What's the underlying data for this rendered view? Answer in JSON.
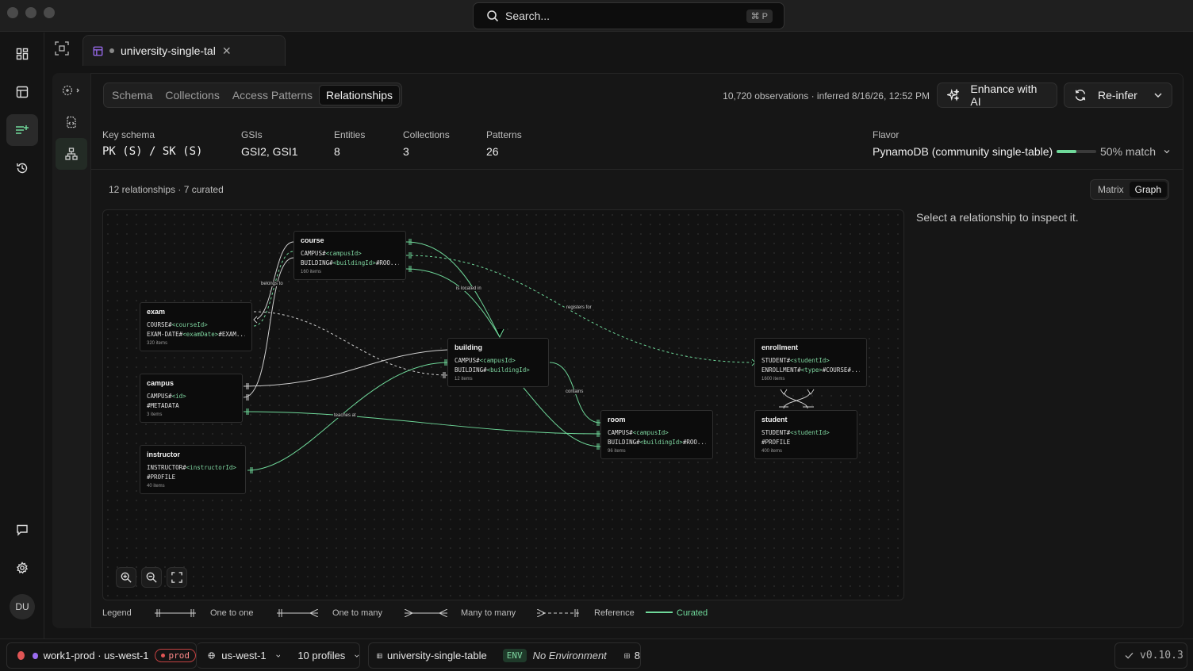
{
  "search": {
    "placeholder": "Search...",
    "shortcut": "⌘ P"
  },
  "tab": {
    "title": "university-single-tal"
  },
  "user": {
    "initials": "DU"
  },
  "view_tabs": [
    "Schema",
    "Collections",
    "Access Patterns",
    "Relationships"
  ],
  "header": {
    "observations": "10,720 observations · inferred 8/16/26, 12:52 PM",
    "enhance_label": "Enhance with AI",
    "reinfer_label": "Re-infer"
  },
  "stats": {
    "key_schema_label": "Key schema",
    "key_schema_value": "PK (S) / SK (S)",
    "gsis_label": "GSIs",
    "gsis_value": "GSI2, GSI1",
    "entities_label": "Entities",
    "entities_value": "8",
    "collections_label": "Collections",
    "collections_value": "3",
    "patterns_label": "Patterns",
    "patterns_value": "26",
    "flavor_label": "Flavor",
    "flavor_value": "PynamoDB (community single-table)",
    "match_fraction": 0.5,
    "match_label": "50% match"
  },
  "relationships": {
    "summary": "12 relationships · 7 curated",
    "view_options": [
      "Matrix",
      "Graph"
    ],
    "active_view": "Graph",
    "inspect_hint": "Select a relationship to inspect it."
  },
  "graph": {
    "nodes": {
      "course": {
        "name": "course",
        "keys": [
          [
            "CAMPUS#",
            "<campusId>",
            ""
          ],
          [
            "BUILDING#",
            "<buildingId>",
            "#ROO..."
          ]
        ],
        "count": "160 items"
      },
      "exam": {
        "name": "exam",
        "keys": [
          [
            "COURSE#",
            "<courseId>",
            ""
          ],
          [
            "EXAM-DATE#",
            "<examDate>",
            "#EXAM..."
          ]
        ],
        "count": "320 items"
      },
      "campus": {
        "name": "campus",
        "keys": [
          [
            "CAMPUS#",
            "<id>",
            ""
          ],
          [
            "#METADATA",
            "",
            ""
          ]
        ],
        "count": "3 items"
      },
      "instructor": {
        "name": "instructor",
        "keys": [
          [
            "INSTRUCTOR#",
            "<instructorId>",
            ""
          ],
          [
            "#PROFILE",
            "",
            ""
          ]
        ],
        "count": "40 items"
      },
      "building": {
        "name": "building",
        "keys": [
          [
            "CAMPUS#",
            "<campusId>",
            ""
          ],
          [
            "BUILDING#",
            "<buildingId>",
            ""
          ]
        ],
        "count": "12 items"
      },
      "room": {
        "name": "room",
        "keys": [
          [
            "CAMPUS#",
            "<campusId>",
            ""
          ],
          [
            "BUILDING#",
            "<buildingId>",
            "#ROO..."
          ]
        ],
        "count": "96 items"
      },
      "enrollment": {
        "name": "enrollment",
        "keys": [
          [
            "STUDENT#",
            "<studentId>",
            ""
          ],
          [
            "ENROLLMENT#",
            "<type>",
            "#COURSE#..."
          ]
        ],
        "count": "1600 items"
      },
      "student": {
        "name": "student",
        "keys": [
          [
            "STUDENT#",
            "<studentId>",
            ""
          ],
          [
            "#PROFILE",
            "",
            ""
          ]
        ],
        "count": "400 items"
      }
    },
    "edge_labels": [
      "belongs to",
      "is located in",
      "registers for",
      "contains",
      "teaches at"
    ]
  },
  "legend": {
    "title": "Legend",
    "one_to_one": "One to one",
    "one_to_many": "One to many",
    "many_to_many": "Many to many",
    "reference": "Reference",
    "curated": "Curated"
  },
  "statusbar": {
    "profile": "work1-prod · us-west-1",
    "env_badge": "prod",
    "region": "us-west-1",
    "profiles": "10 profiles",
    "table": "university-single-table",
    "env_chip": "ENV",
    "environment": "No Environment",
    "table_count": "8",
    "version": "v0.10.3"
  },
  "colors": {
    "accent": "#6fd99a",
    "danger": "#e05555",
    "purple": "#9b6cf0"
  }
}
